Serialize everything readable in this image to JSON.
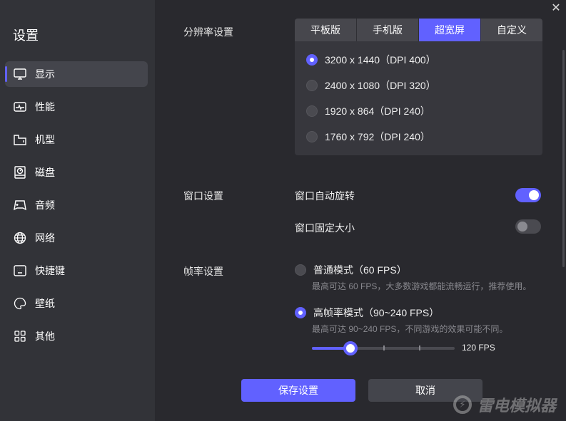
{
  "sidebar": {
    "title": "设置",
    "items": [
      {
        "label": "显示",
        "icon": "monitor-icon"
      },
      {
        "label": "性能",
        "icon": "pulse-icon"
      },
      {
        "label": "机型",
        "icon": "folder-icon"
      },
      {
        "label": "磁盘",
        "icon": "disk-icon"
      },
      {
        "label": "音频",
        "icon": "gamepad-icon"
      },
      {
        "label": "网络",
        "icon": "globe-icon"
      },
      {
        "label": "快捷键",
        "icon": "keyboard-icon"
      },
      {
        "label": "壁纸",
        "icon": "palette-icon"
      },
      {
        "label": "其他",
        "icon": "grid-icon"
      }
    ]
  },
  "resolution": {
    "label": "分辨率设置",
    "tabs": [
      "平板版",
      "手机版",
      "超宽屏",
      "自定义"
    ],
    "active_tab": "超宽屏",
    "options": [
      "3200 x 1440（DPI 400）",
      "2400 x 1080（DPI 320）",
      "1920 x 864（DPI 240）",
      "1760 x 792（DPI 240）"
    ],
    "selected": 0
  },
  "window": {
    "label": "窗口设置",
    "auto_rotate": "窗口自动旋转",
    "auto_rotate_on": true,
    "fixed_size": "窗口固定大小",
    "fixed_size_on": false
  },
  "framerate": {
    "label": "帧率设置",
    "normal": {
      "title": "普通模式（60 FPS）",
      "desc": "最高可达 60 FPS，大多数游戏都能流畅运行，推荐使用。"
    },
    "high": {
      "title": "高帧率模式（90~240 FPS）",
      "desc": "最高可达 90~240 FPS，不同游戏的效果可能不同。"
    },
    "selected": "high",
    "slider_value": "120 FPS",
    "slider_fraction": 0.27
  },
  "buttons": {
    "save": "保存设置",
    "cancel": "取消"
  },
  "logo": "雷电模拟器",
  "accent": "#6161ff"
}
